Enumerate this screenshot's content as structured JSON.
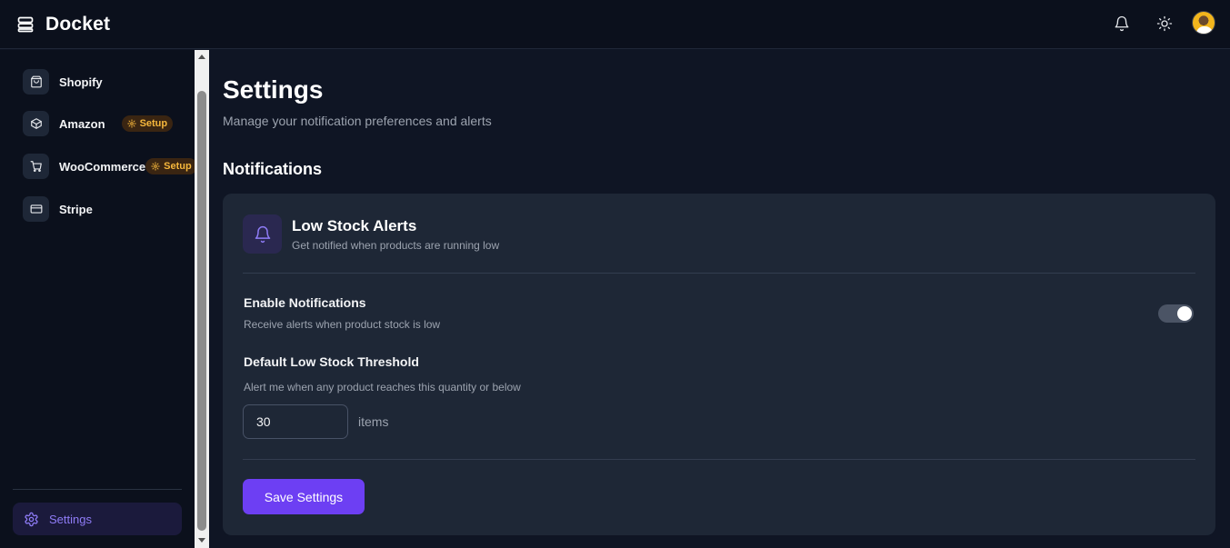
{
  "app": {
    "name": "Docket"
  },
  "header": {
    "icons": {
      "notifications": "bell-icon",
      "theme": "sun-icon",
      "avatar": "user-avatar"
    }
  },
  "sidebar": {
    "items": [
      {
        "label": "Shopify",
        "icon": "shopping-bag-icon"
      },
      {
        "label": "Amazon",
        "icon": "box-icon",
        "badge": "Setup"
      },
      {
        "label": "WooCommerce",
        "icon": "cart-icon",
        "badge": "Setup"
      },
      {
        "label": "Stripe",
        "icon": "credit-card-icon"
      }
    ],
    "footer": {
      "label": "Settings",
      "icon": "gear-icon"
    }
  },
  "main": {
    "title": "Settings",
    "subtitle": "Manage your notification preferences and alerts",
    "section_title": "Notifications",
    "card": {
      "title": "Low Stock Alerts",
      "description": "Get notified when products are running low",
      "enable": {
        "title": "Enable Notifications",
        "description": "Receive alerts when product stock is low",
        "enabled": true
      },
      "threshold": {
        "title": "Default Low Stock Threshold",
        "description": "Alert me when any product reaches this quantity or below",
        "value": "30",
        "unit": "items"
      },
      "save_label": "Save Settings"
    }
  },
  "colors": {
    "accent": "#6d3ff3",
    "badge_text": "#f6b73c",
    "active_nav_text": "#8f7cf7"
  }
}
